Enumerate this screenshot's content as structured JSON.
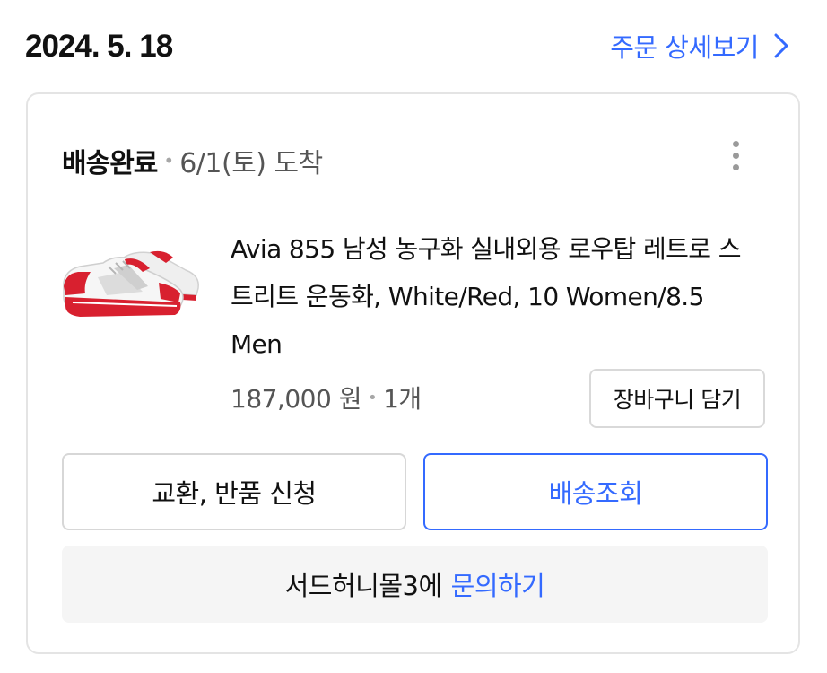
{
  "order": {
    "date": "2024. 5. 18",
    "detail_link_label": "주문 상세보기"
  },
  "shipment": {
    "status": "배송완료",
    "arrival": "6/1(토) 도착"
  },
  "product": {
    "name": "Avia 855 남성 농구화 실내외용 로우탑 레트로 스트리트 운동화, White/Red, 10 Women/8.5 Men",
    "price": "187,000 원",
    "quantity": "1개",
    "image_icon": "sneaker-image"
  },
  "buttons": {
    "add_to_cart": "장바구니 담기",
    "exchange_return": "교환, 반품 신청",
    "track_delivery": "배송조회"
  },
  "inquiry": {
    "seller_text": "서드허니몰3에",
    "link_label": "문의하기"
  },
  "colors": {
    "accent": "#346aff",
    "text": "#111111",
    "muted": "#555555",
    "border": "#e4e4e4",
    "panel": "#f5f5f5",
    "product_red": "#d8202f"
  }
}
